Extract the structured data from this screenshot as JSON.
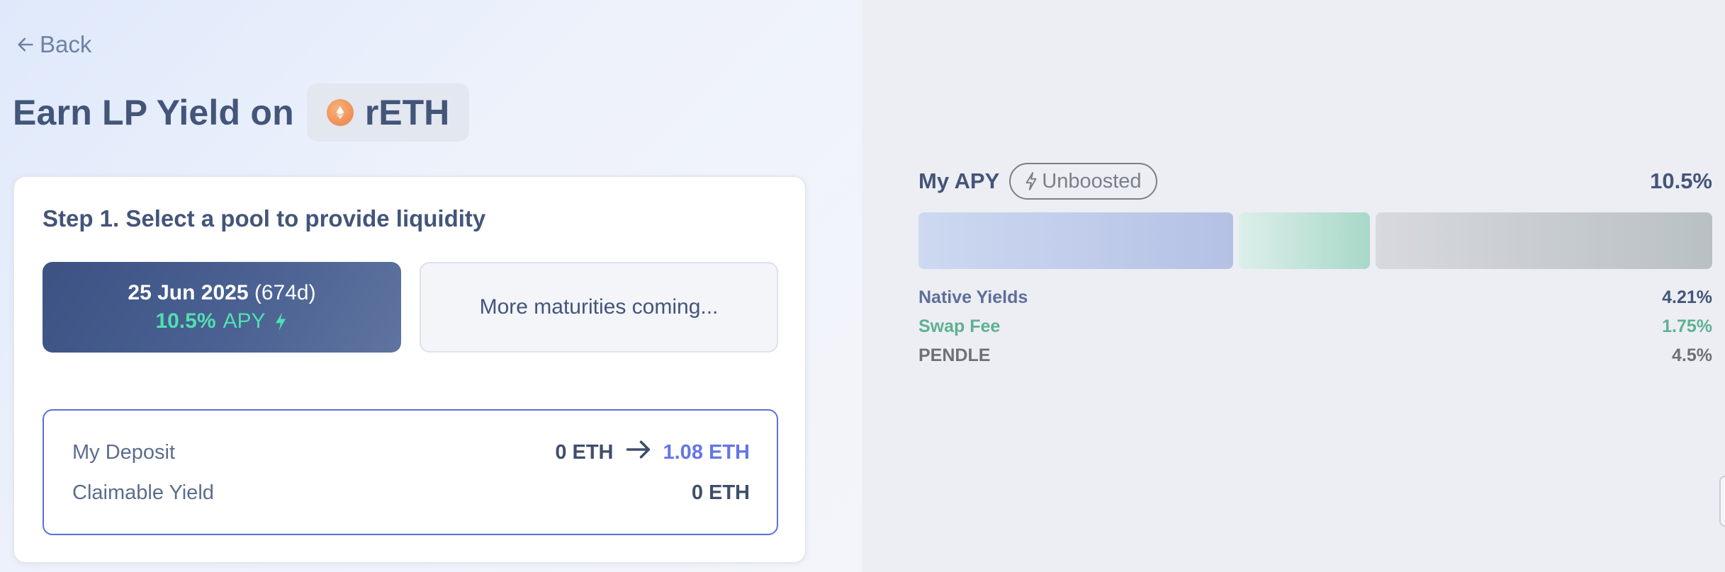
{
  "nav": {
    "back_label": "Back"
  },
  "header": {
    "title": "Earn LP Yield on",
    "token_symbol": "rETH"
  },
  "step": {
    "title": "Step 1. Select a pool to provide liquidity",
    "selected_pool": {
      "date": "25 Jun 2025",
      "days": "(674d)",
      "apy_value": "10.5%",
      "apy_label": "APY"
    },
    "more_label": "More maturities coming..."
  },
  "deposit": {
    "my_deposit_label": "My Deposit",
    "my_deposit_current": "0 ETH",
    "my_deposit_new": "1.08 ETH",
    "claimable_label": "Claimable Yield",
    "claimable_value": "0 ETH"
  },
  "apy_panel": {
    "label": "My APY",
    "boost_label": "Unboosted",
    "total": "10.5%",
    "breakdown": [
      {
        "name": "Native Yields",
        "value": "4.21%",
        "percent": 4.21,
        "color": "#5d6f99"
      },
      {
        "name": "Swap Fee",
        "value": "1.75%",
        "percent": 1.75,
        "color": "#5fb092"
      },
      {
        "name": "PENDLE",
        "value": "4.5%",
        "percent": 4.5,
        "color": "#6d7076"
      }
    ]
  }
}
